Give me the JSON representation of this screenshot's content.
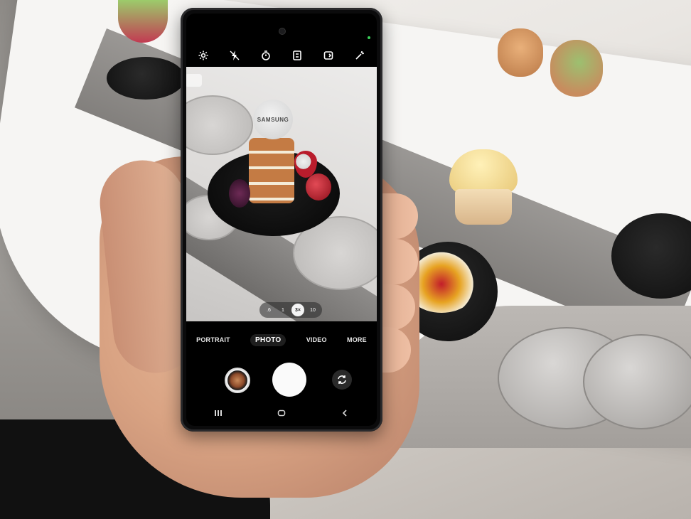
{
  "camera": {
    "top_icons": [
      "settings-icon",
      "flash-off-icon",
      "timer-icon",
      "aspect-ratio-icon",
      "motion-photo-icon",
      "filters-icon"
    ],
    "viewfinder_sign": "SAMSUNG",
    "zoom": {
      "options": [
        ".6",
        "1",
        "3×",
        "10"
      ],
      "selected": "3×"
    },
    "modes": {
      "portrait": "PORTRAIT",
      "photo": "PHOTO",
      "video": "VIDEO",
      "more": "MORE",
      "selected": "PHOTO"
    },
    "controls": {
      "gallery": "gallery-thumbnail",
      "shutter": "shutter-button",
      "switch": "switch-camera-icon"
    },
    "nav": [
      "recents-icon",
      "home-icon",
      "back-icon"
    ]
  },
  "colors": {
    "accent": "#ffffff",
    "status_dot": "#3ad15a"
  }
}
